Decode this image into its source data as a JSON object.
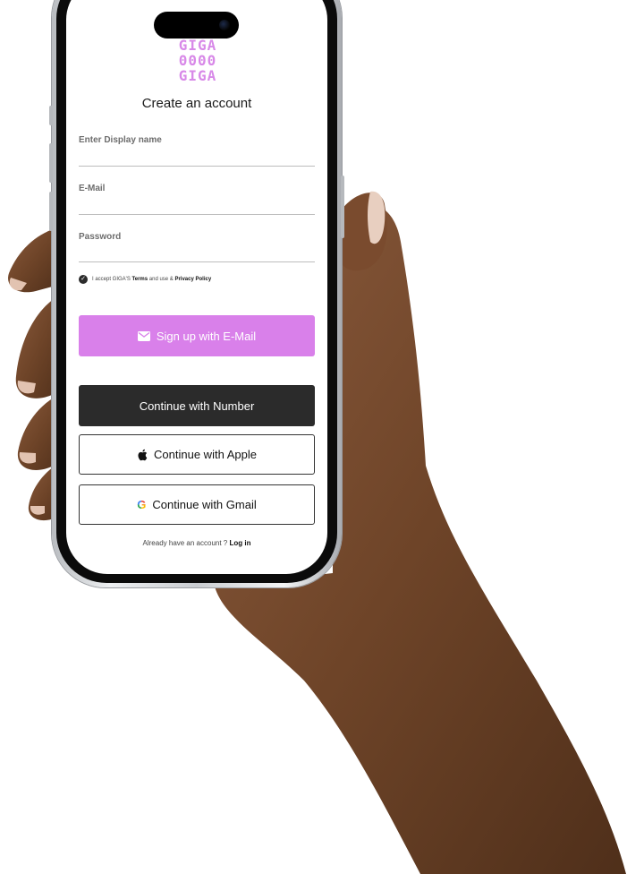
{
  "logo": {
    "lines": [
      "GIGA",
      "0000",
      "GIGA"
    ]
  },
  "signup": {
    "title": "Create an account",
    "fields": {
      "display_name": {
        "placeholder": "Enter Display name",
        "value": ""
      },
      "email": {
        "placeholder": "E-Mail",
        "value": ""
      },
      "password": {
        "placeholder": "Password",
        "value": ""
      }
    },
    "terms": {
      "prefix": "I accept GIGA'S",
      "terms_link": "Terms",
      "middle": "and use &",
      "privacy_link": "Privacy Policy",
      "checked": true
    },
    "buttons": {
      "email": "Sign up with E-Mail",
      "number": "Continue with Number",
      "apple": "Continue with Apple",
      "gmail": "Continue with Gmail"
    },
    "login": {
      "prompt": "Already have an account ?",
      "link": "Log in"
    }
  },
  "colors": {
    "accent": "#d980ea",
    "dark_button": "#2b2b2b",
    "logo": "#d889e8"
  },
  "icons": {
    "check": "check-circle-icon",
    "email": "mail-icon",
    "apple": "apple-logo-icon",
    "google": "google-g-icon"
  }
}
